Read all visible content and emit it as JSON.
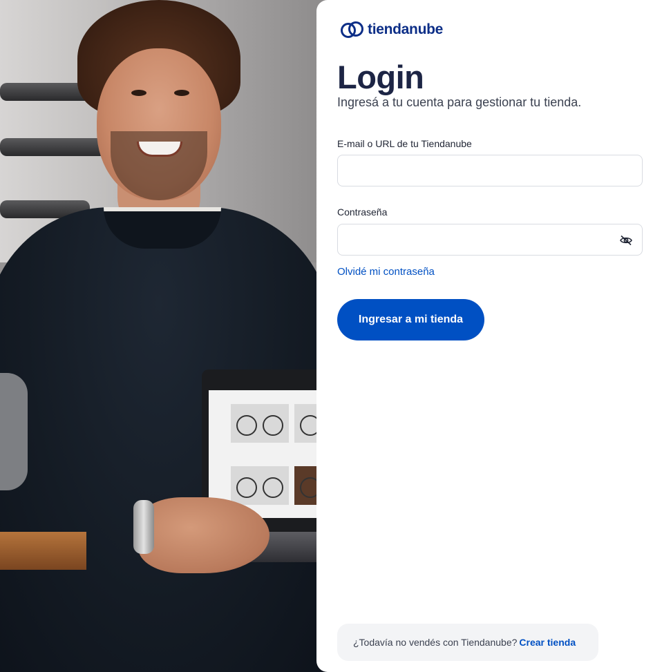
{
  "brand": {
    "name": "tiendanube",
    "color": "#0c2e87",
    "logo_icon": "cloud-logo-icon"
  },
  "hero": {
    "image": "smiling man holding laptop showing bicycle store"
  },
  "login": {
    "title": "Login",
    "subtitle": "Ingresá a tu cuenta para gestionar tu tienda.",
    "email_label": "E-mail o URL de tu Tiendanube",
    "email_value": "",
    "password_label": "Contraseña",
    "password_value": "",
    "password_toggle_icon": "eye-slash-icon",
    "forgot_link": "Olvidé mi contraseña",
    "submit_label": "Ingresar a mi tienda"
  },
  "footer": {
    "prompt": "¿Todavía no vendés con Tiendanube?",
    "cta": "Crear tienda"
  },
  "colors": {
    "primary": "#0050c3",
    "heading": "#1d2545",
    "input_border": "#d8dbe1",
    "footer_bg": "#f3f4f6"
  }
}
